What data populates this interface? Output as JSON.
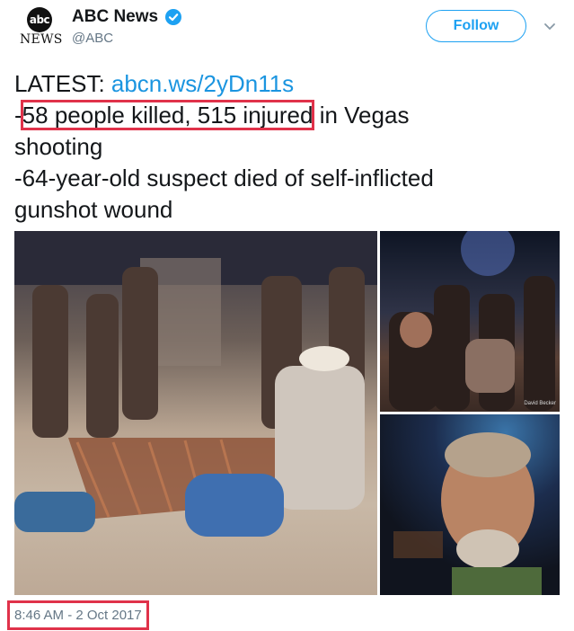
{
  "header": {
    "avatar_top": "abc",
    "avatar_bottom": "NEWS",
    "name": "ABC News",
    "handle": "@ABC",
    "follow_label": "Follow"
  },
  "tweet": {
    "latest_prefix": "LATEST: ",
    "link": "abcn.ws/2yDn11s",
    "dash1": "-",
    "highlight": "58 people killed, 515 injured",
    "line1_rest": " in Vegas",
    "line2": "shooting",
    "line3": "-64-year-old suspect died of self-inflicted",
    "line4": "gunshot wound"
  },
  "photos": {
    "credit": "David Becker"
  },
  "timestamp": "8:46 AM - 2 Oct 2017",
  "colors": {
    "accent": "#1da1f2",
    "link": "#1b95e0",
    "highlight_box": "#e0324a",
    "muted": "#657786"
  }
}
